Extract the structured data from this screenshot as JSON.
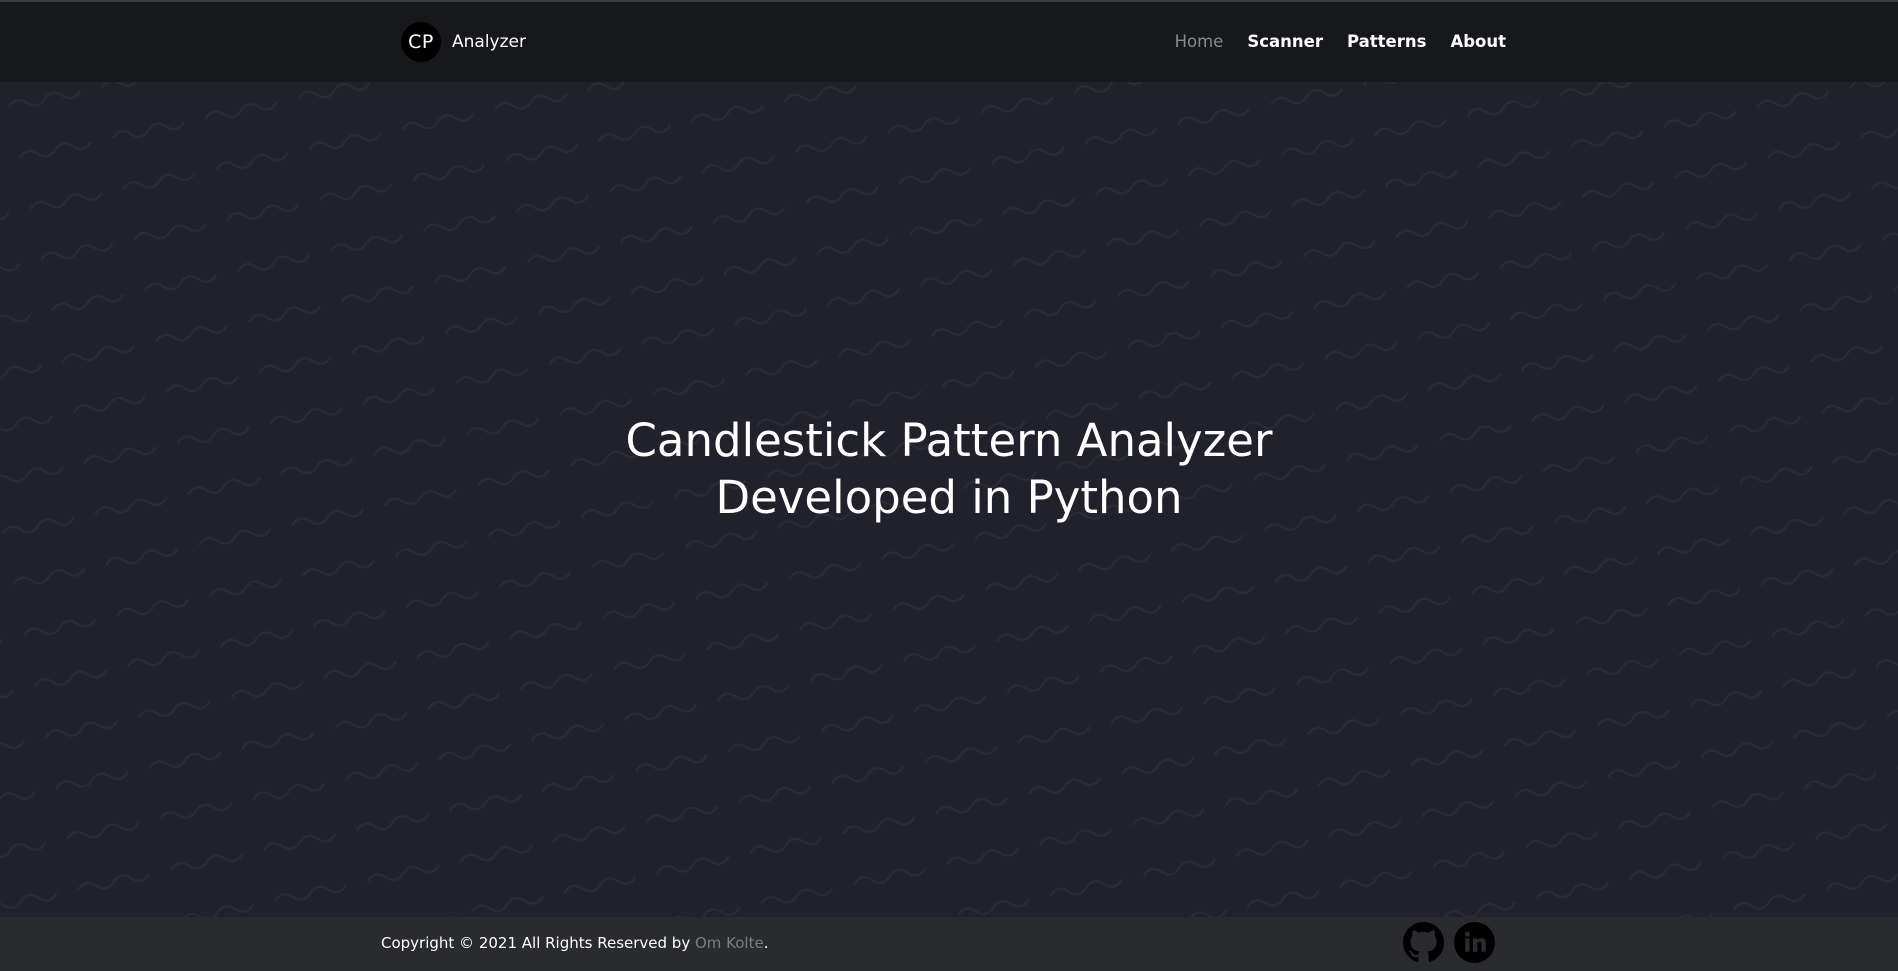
{
  "navbar": {
    "brand_logo_text": "CP",
    "brand_text": "Analyzer",
    "links": [
      {
        "label": "Home",
        "active": true
      },
      {
        "label": "Scanner",
        "active": false
      },
      {
        "label": "Patterns",
        "active": false
      },
      {
        "label": "About",
        "active": false
      }
    ]
  },
  "hero": {
    "title_line1": "Candlestick Pattern Analyzer",
    "title_line2": "Developed in Python"
  },
  "footer": {
    "copyright_prefix": "Copyright © 2021 All Rights Reserved by ",
    "author": "Om Kolte",
    "copyright_suffix": ".",
    "social_icons": [
      "github-icon",
      "linkedin-icon"
    ]
  },
  "colors": {
    "navbar_bg": "#17181c",
    "hero_bg": "#20212b",
    "footer_bg": "#2a2b2f",
    "active_link": "#8a8b91",
    "author_link": "#7d7e84"
  }
}
